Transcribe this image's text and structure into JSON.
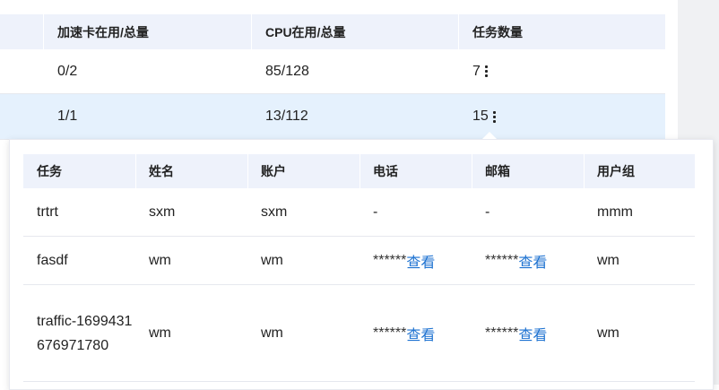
{
  "outer_table": {
    "headers": [
      "加速卡在用/总量",
      "CPU在用/总量",
      "任务数量"
    ],
    "rows": [
      {
        "gpu": "0/2",
        "cpu": "85/128",
        "tasks": "7"
      },
      {
        "gpu": "1/1",
        "cpu": "13/112",
        "tasks": "15"
      }
    ]
  },
  "task_popover": {
    "headers": [
      "任务",
      "姓名",
      "账户",
      "电话",
      "邮箱",
      "用户组"
    ],
    "rows": [
      {
        "task": "trtrt",
        "name": "sxm",
        "account": "sxm",
        "phone": "-",
        "phone_link": "",
        "email": "-",
        "email_link": "",
        "group": "mmm"
      },
      {
        "task": "fasdf",
        "name": "wm",
        "account": "wm",
        "phone": "******",
        "phone_link": "查看",
        "email": "******",
        "email_link": "查看",
        "group": "wm"
      },
      {
        "task": "traffic-1699431676971780",
        "name": "wm",
        "account": "wm",
        "phone": "******",
        "phone_link": "查看",
        "email": "******",
        "email_link": "查看",
        "group": "wm"
      }
    ]
  },
  "colors": {
    "header_bg": "#eef2fb",
    "highlight_row": "#e5f1fd",
    "link": "#1d72d1"
  }
}
